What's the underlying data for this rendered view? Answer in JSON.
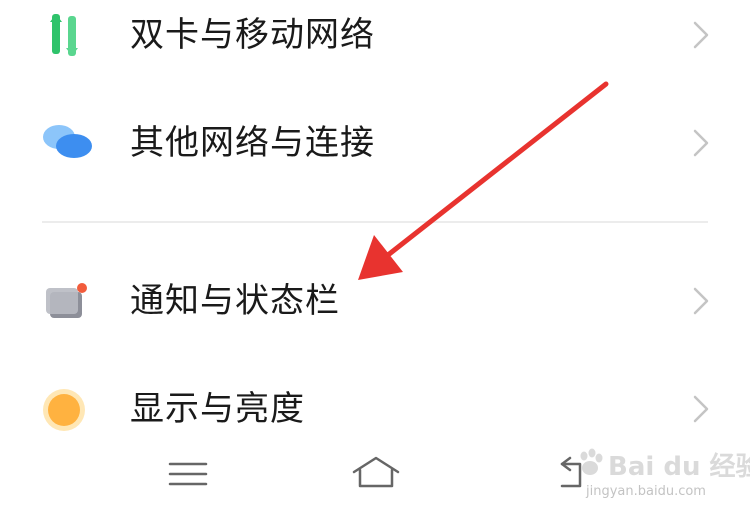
{
  "settings": {
    "items": [
      {
        "label": "双卡与移动网络",
        "icon": "dual-sim-icon"
      },
      {
        "label": "其他网络与连接",
        "icon": "network-connection-icon"
      },
      {
        "label": "通知与状态栏",
        "icon": "notification-icon"
      },
      {
        "label": "显示与亮度",
        "icon": "brightness-icon"
      }
    ]
  },
  "nav": {
    "menu_icon": "menu-icon",
    "home_icon": "home-icon",
    "back_icon": "back-icon"
  },
  "watermark": {
    "title": "Bai du 经验",
    "url": "jingyan.baidu.com"
  },
  "colors": {
    "arrow": "#e8332f",
    "dual_sim_green": "#2fc36b",
    "network_blue": "#3d8ef0",
    "notification_red": "#f25c3c",
    "brightness_orange": "#ffb240"
  }
}
